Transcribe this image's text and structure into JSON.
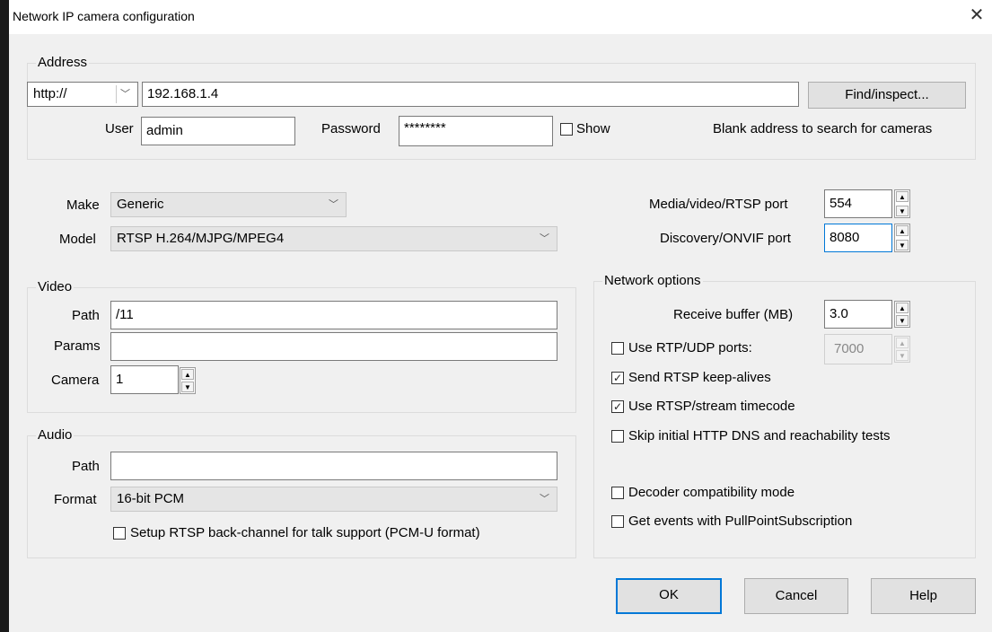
{
  "dialog": {
    "title": "Network IP camera configuration",
    "close_glyph": "✕"
  },
  "address": {
    "legend": "Address",
    "protocol": "http://",
    "ip": "192.168.1.4",
    "find_button": "Find/inspect...",
    "user_label": "User",
    "user_value": "admin",
    "password_label": "Password",
    "password_value": "********",
    "show_label": "Show",
    "show_checked": false,
    "hint": "Blank address to search for cameras"
  },
  "camera": {
    "make_label": "Make",
    "make_value": "Generic",
    "model_label": "Model",
    "model_value": "RTSP H.264/MJPG/MPEG4",
    "media_port_label": "Media/video/RTSP port",
    "media_port_value": "554",
    "discovery_port_label": "Discovery/ONVIF port",
    "discovery_port_value": "8080"
  },
  "video": {
    "legend": "Video",
    "path_label": "Path",
    "path_value": "/11",
    "params_label": "Params",
    "params_value": "",
    "camera_label": "Camera",
    "camera_value": "1"
  },
  "audio": {
    "legend": "Audio",
    "path_label": "Path",
    "path_value": "",
    "format_label": "Format",
    "format_value": "16-bit PCM",
    "backchannel_label": "Setup RTSP back-channel for talk support (PCM-U format)",
    "backchannel_checked": false
  },
  "network": {
    "legend": "Network options",
    "receive_buffer_label": "Receive buffer (MB)",
    "receive_buffer_value": "3.0",
    "rtp_udp_label": "Use RTP/UDP ports:",
    "rtp_udp_checked": false,
    "rtp_udp_value": "7000",
    "keepalive_label": "Send RTSP keep-alives",
    "keepalive_checked": true,
    "timecode_label": "Use RTSP/stream timecode",
    "timecode_checked": true,
    "skip_dns_label": "Skip initial HTTP DNS and reachability tests",
    "skip_dns_checked": false,
    "decoder_label": "Decoder compatibility mode",
    "decoder_checked": false,
    "pullpoint_label": "Get events with PullPointSubscription",
    "pullpoint_checked": false
  },
  "buttons": {
    "ok": "OK",
    "cancel": "Cancel",
    "help": "Help"
  },
  "icons": {
    "check": "✓",
    "chevron": "﹀",
    "spin_up": "▲",
    "spin_down": "▼"
  }
}
